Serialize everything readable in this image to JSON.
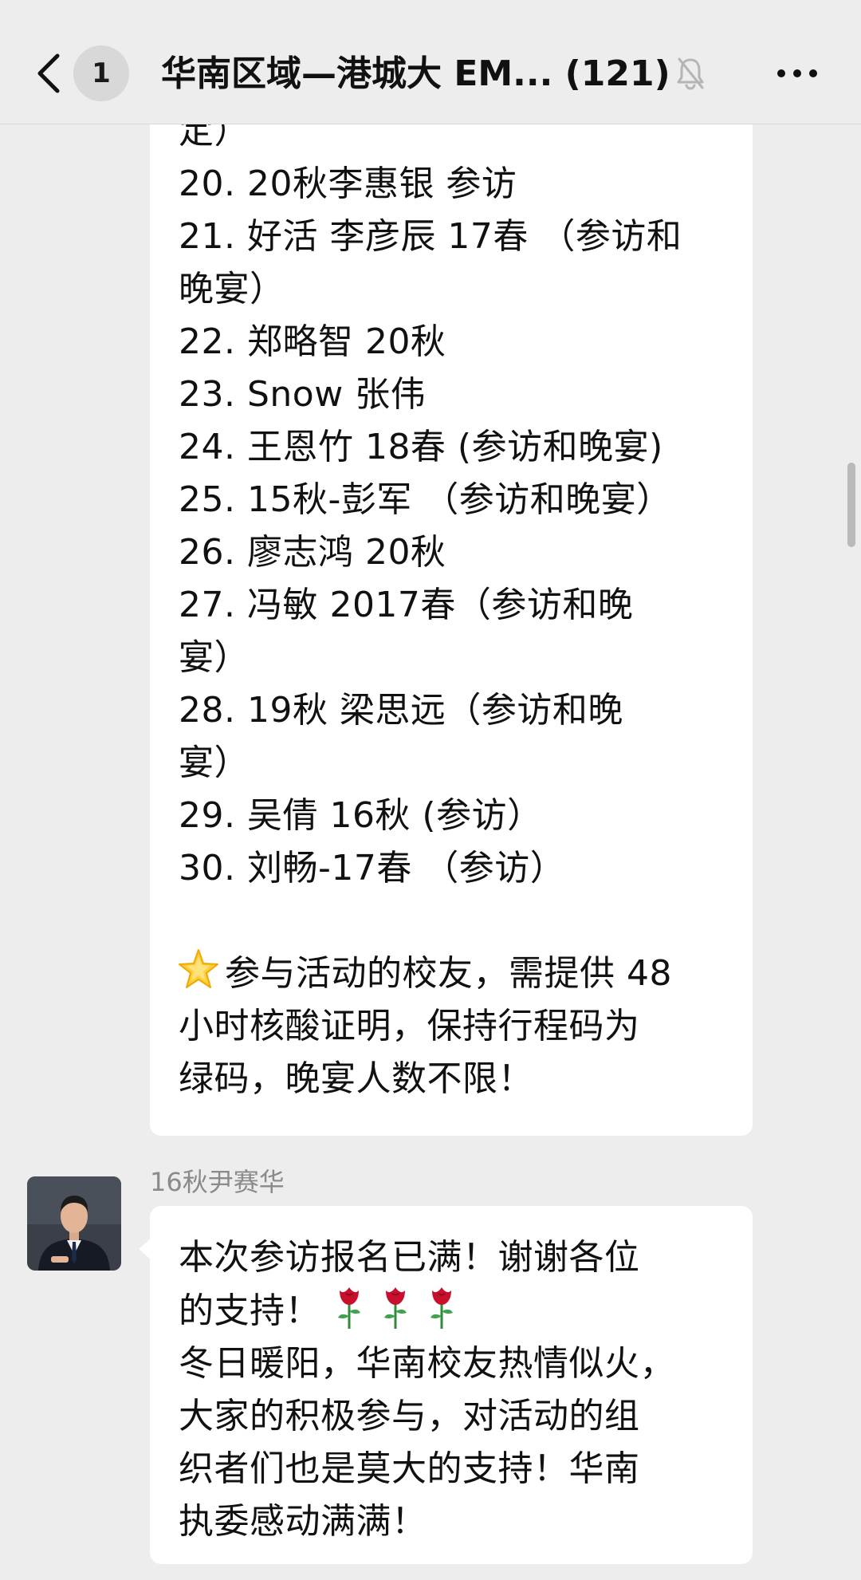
{
  "header": {
    "unread_count": "1",
    "title": "华南区域—港城大 EM... (121)"
  },
  "messages": [
    {
      "lines": [
        "定）",
        "20. 20秋李惠银 参访",
        "21. 好活 李彦辰 17春 （参访和",
        "晚宴）",
        "22. 郑略智 20秋",
        "23. Snow 张伟",
        "24. 王恩竹 18春 (参访和晚宴)",
        "25. 15秋-彭军 （参访和晚宴）",
        "26. 廖志鸿 20秋",
        "27. 冯敏 2017春（参访和晚",
        "宴）",
        "28. 19秋 梁思远（参访和晚",
        "宴）",
        "29. 吴倩 16秋 (参访）",
        "30. 刘畅-17春 （参访）"
      ],
      "note_lines": [
        "参与活动的校友，需提供 48",
        "小时核酸证明，保持行程码为",
        "绿码，晚宴人数不限！"
      ]
    },
    {
      "sender": "16秋尹赛华",
      "first_line": "本次参访报名已满！谢谢各位",
      "second_line": "的支持！",
      "rest_lines": [
        "冬日暖阳，华南校友热情似火，",
        "大家的积极参与，对活动的组",
        "织者们也是莫大的支持！华南",
        "执委感动满满！"
      ]
    }
  ],
  "colors": {
    "background": "#ededed",
    "bubble": "#ffffff",
    "text": "#111111",
    "sender_name": "#8a8a8a",
    "rose": "#c8102e"
  },
  "icons": [
    "back-arrow-icon",
    "mute-bell-icon",
    "more-dots-icon",
    "star-icon",
    "rose-icon"
  ]
}
